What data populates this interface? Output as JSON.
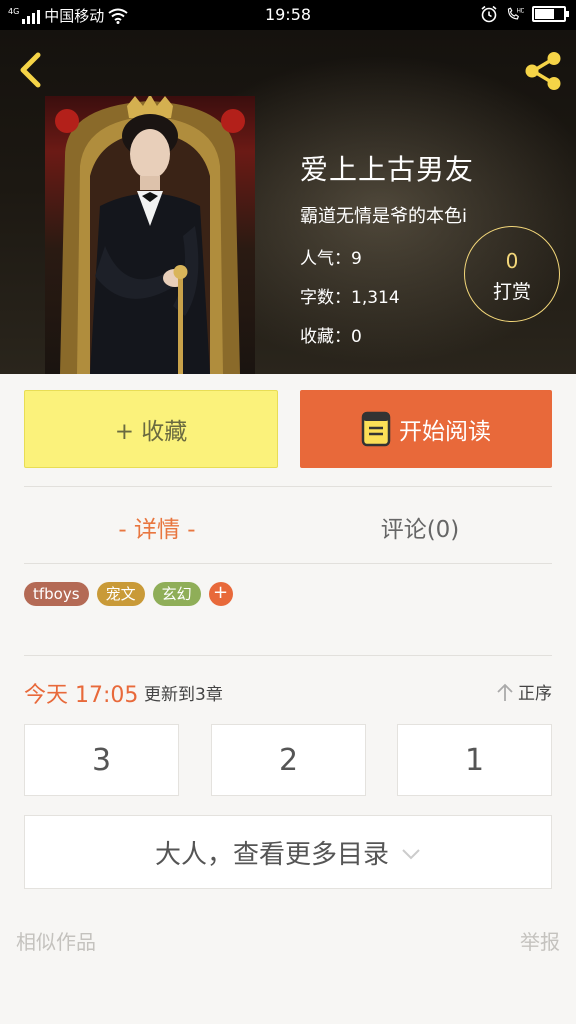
{
  "status_bar": {
    "network": "4G",
    "carrier": "中国移动",
    "time": "19:58",
    "call_badge": "HD",
    "battery_level": 0.62
  },
  "book": {
    "title": "爱上上古男友",
    "subtitle": "霸道无情是爷的本色i",
    "popularity": "人气：9",
    "word_count": "字数：1,314",
    "favorites": "收藏：0"
  },
  "reward": {
    "count": "0",
    "label": "打赏"
  },
  "actions": {
    "collect_label": "+ 收藏",
    "read_label": "开始阅读"
  },
  "tabs": {
    "details": "- 详情 -",
    "comments": "评论(0)"
  },
  "tags": [
    {
      "label": "tfboys",
      "color": "#b46a55"
    },
    {
      "label": "宠文",
      "color": "#c99a38"
    },
    {
      "label": "玄幻",
      "color": "#8fae58"
    }
  ],
  "tag_add": "+",
  "update": {
    "time": "今天 17:05",
    "note": "更新到3章",
    "sort_label": "正序"
  },
  "chapters": [
    "3",
    "2",
    "1"
  ],
  "more_chapters": "大人，查看更多目录",
  "footer": {
    "similar": "相似作品",
    "report": "举报"
  },
  "colors": {
    "accent": "#e8693a",
    "collect": "#fbf27b",
    "reward_ring": "#f3d77a"
  }
}
